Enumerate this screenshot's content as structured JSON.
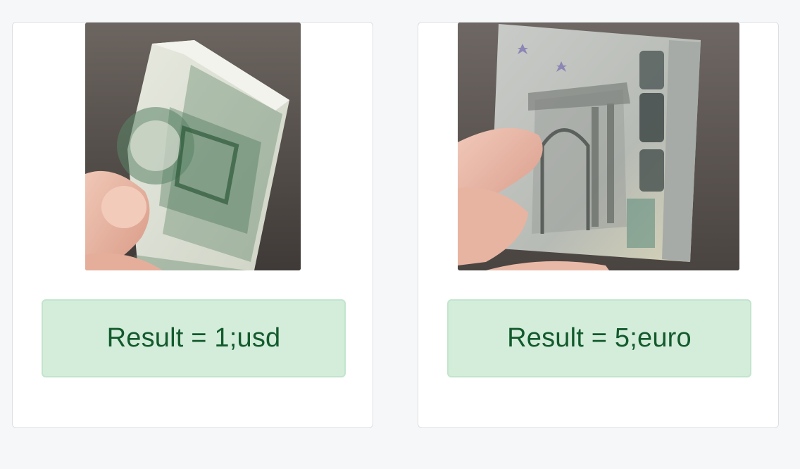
{
  "cards": [
    {
      "image_alt": "Folded 1 dollar banknote held in hand",
      "result_label": "Result = 1;usd"
    },
    {
      "image_alt": "Folded 5 euro banknote held in hand",
      "result_label": "Result = 5;euro"
    }
  ],
  "colors": {
    "page_background": "#f6f7f9",
    "card_background": "#ffffff",
    "result_background": "#d4eddb",
    "result_text": "#135a2c"
  }
}
